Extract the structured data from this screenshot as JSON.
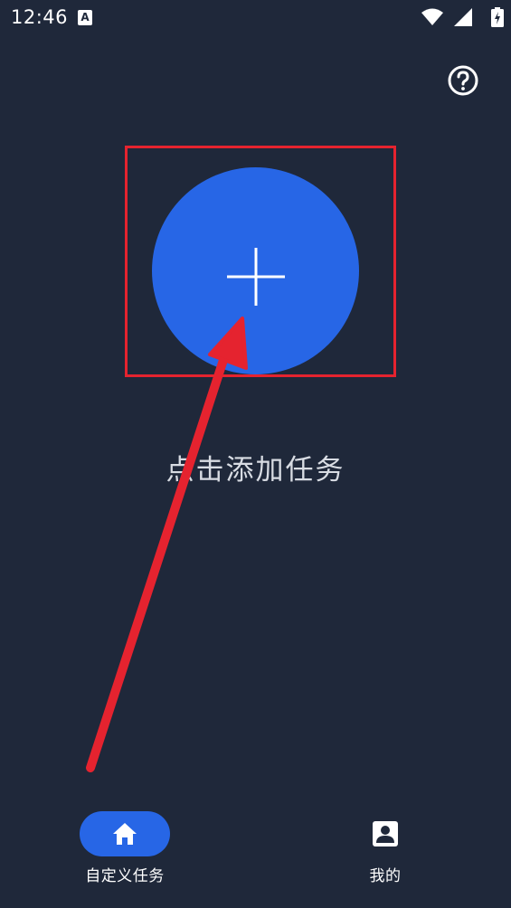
{
  "status_bar": {
    "time": "12:46",
    "app_icon_letter": "A"
  },
  "main": {
    "add_task_hint": "点击添加任务",
    "help_icon": "help-circle-icon",
    "add_icon": "plus-icon"
  },
  "bottom_nav": {
    "items": [
      {
        "label": "自定义任务",
        "icon": "home-icon",
        "selected": true
      },
      {
        "label": "我的",
        "icon": "profile-icon",
        "selected": false
      }
    ]
  },
  "colors": {
    "background": "#1f283a",
    "accent": "#2766e6",
    "highlight": "#e5232f"
  }
}
